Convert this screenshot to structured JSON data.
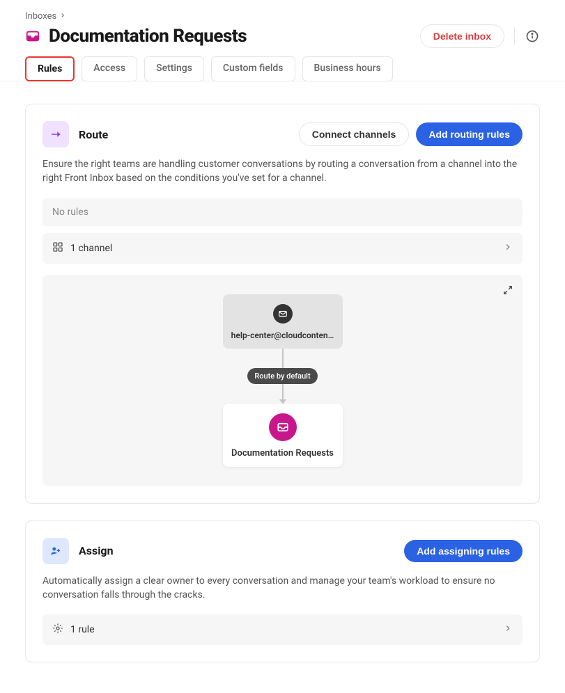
{
  "breadcrumb": {
    "root": "Inboxes"
  },
  "header": {
    "title": "Documentation Requests",
    "delete_label": "Delete inbox"
  },
  "tabs": [
    {
      "label": "Rules",
      "active": true
    },
    {
      "label": "Access"
    },
    {
      "label": "Settings"
    },
    {
      "label": "Custom fields"
    },
    {
      "label": "Business hours"
    }
  ],
  "route": {
    "title": "Route",
    "connect_label": "Connect channels",
    "add_label": "Add routing rules",
    "description": "Ensure the right teams are handling customer conversations by routing a conversation from a channel into the right Front Inbox based on the conditions you've set for a channel.",
    "no_rules": "No rules",
    "channel_count": "1 channel",
    "diagram": {
      "channel_email": "help-center@cloudconten…",
      "route_badge": "Route by default",
      "inbox_name": "Documentation Requests"
    }
  },
  "assign": {
    "title": "Assign",
    "add_label": "Add assigning rules",
    "description": "Automatically assign a clear owner to every conversation and manage your team's workload to ensure no conversation falls through the cracks.",
    "rule_count": "1 rule"
  },
  "colors": {
    "accent": "#2b62e3",
    "danger": "#d93f3f",
    "magenta": "#c7178b",
    "highlight_border": "#e8362c"
  }
}
